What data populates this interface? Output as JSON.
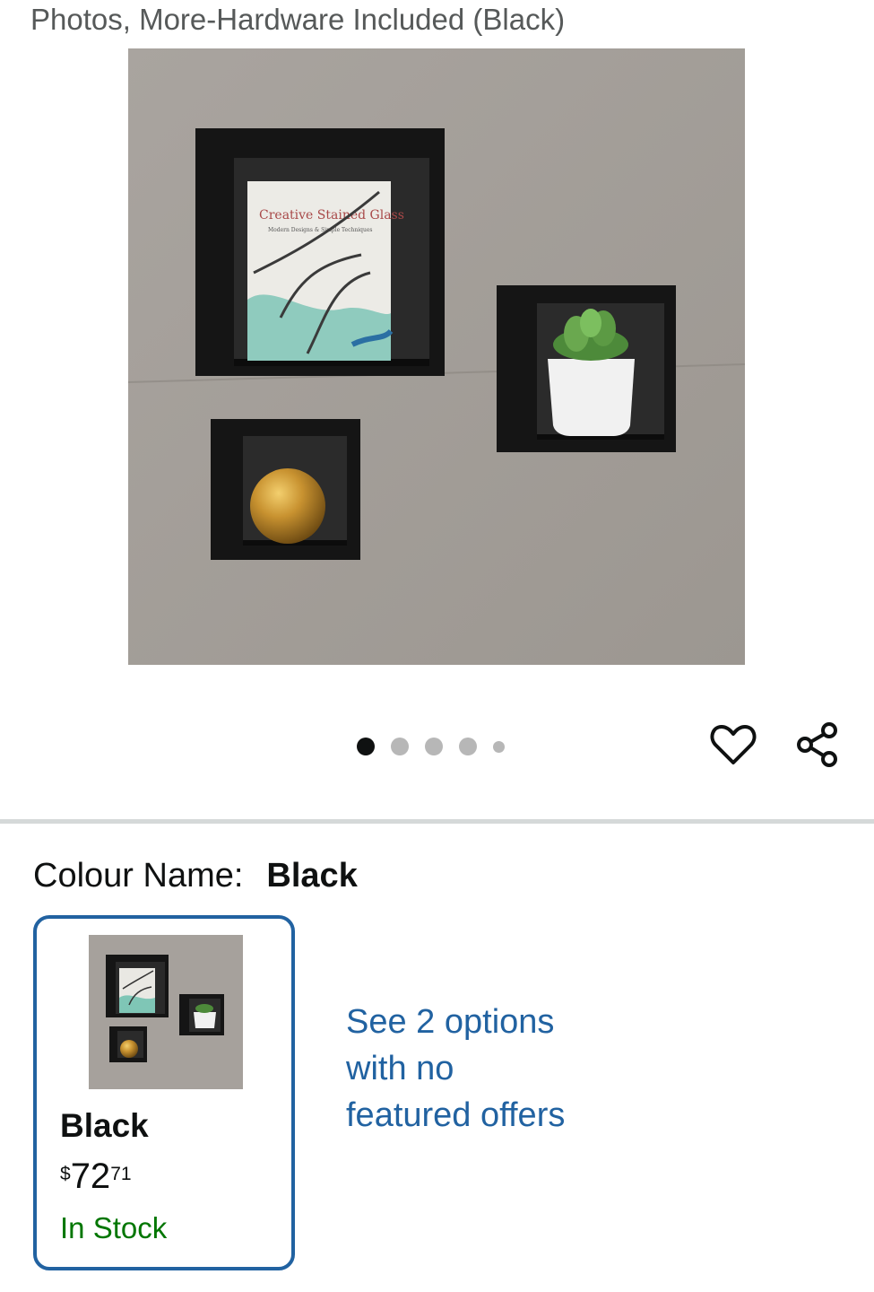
{
  "header": {
    "title_tail": "Photos, More-Hardware Included (Black)"
  },
  "gallery": {
    "image_count": 5,
    "active_index": 0,
    "book_title": "Creative Stained Glass",
    "book_subtitle": "Modern Designs & Simple Techniques"
  },
  "icons": {
    "wishlist": "heart-icon",
    "share": "share-icon"
  },
  "colour": {
    "label": "Colour Name:",
    "value": "Black"
  },
  "variant": {
    "name": "Black",
    "price_symbol": "$",
    "price_whole": "72",
    "price_fraction": "71",
    "stock": "In Stock"
  },
  "other_options": {
    "text": "See 2 options with no featured offers"
  },
  "colors": {
    "link": "#2162a1",
    "stock": "#007600",
    "selected_border": "#2162a1"
  }
}
